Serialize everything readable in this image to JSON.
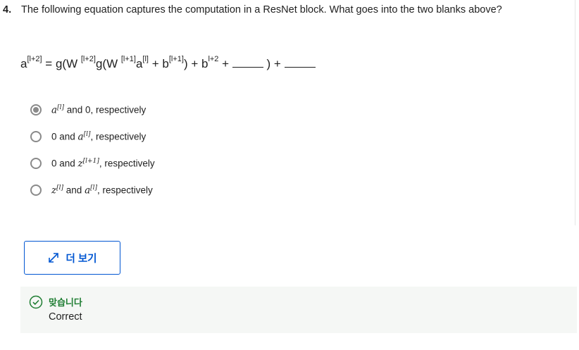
{
  "question": {
    "number": "4.",
    "text": "The following equation captures the computation in a ResNet block. What goes into the two blanks above?"
  },
  "equation": {
    "p1": "a",
    "s1": "[l+2]",
    "p2": " = g(W ",
    "s2": "[l+2]",
    "p3": "g(W ",
    "s3": "[l+1]",
    "p4": "a",
    "s4": "[l]",
    "p5": " + b",
    "s5": "[l+1]",
    "p6": ") + b",
    "s6": "l+2",
    "p7": " + ",
    "p8": " ) + "
  },
  "options": [
    {
      "a": "a",
      "a_sup": "[l]",
      "mid": " and 0, respectively",
      "b": "",
      "b_sup": "",
      "tail": "",
      "selected": true
    },
    {
      "a": "",
      "a_sup": "",
      "mid": "0 and ",
      "b": "a",
      "b_sup": "[l]",
      "tail": ", respectively",
      "selected": false
    },
    {
      "a": "",
      "a_sup": "",
      "mid": "0 and ",
      "b": "z",
      "b_sup": "[l+1]",
      "tail": ", respectively",
      "selected": false
    },
    {
      "a": "z",
      "a_sup": "[l]",
      "mid": " and ",
      "b": "a",
      "b_sup": "[l]",
      "tail": ", respectively",
      "selected": false
    }
  ],
  "more_button": {
    "label": "더 보기",
    "icon": "expand-icon"
  },
  "result": {
    "title": "맞습니다",
    "text": "Correct",
    "icon": "check-circle-icon",
    "color": "#1e7d32"
  }
}
